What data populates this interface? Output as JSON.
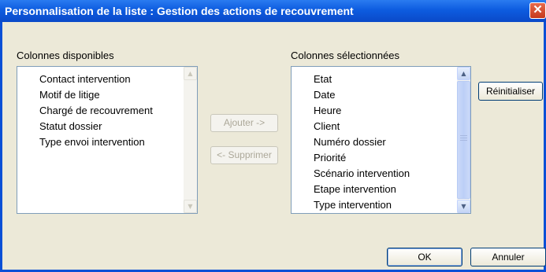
{
  "window": {
    "title": "Personnalisation de la liste : Gestion des actions de recouvrement",
    "close_glyph": "✕"
  },
  "available": {
    "label": "Colonnes disponibles",
    "items": [
      "Contact intervention",
      "Motif de litige",
      "Chargé de recouvrement",
      "Statut dossier",
      "Type envoi intervention"
    ]
  },
  "selected": {
    "label": "Colonnes sélectionnées",
    "items": [
      "Etat",
      "Date",
      "Heure",
      "Client",
      "Numéro dossier",
      "Priorité",
      "Scénario intervention",
      "Etape intervention",
      "Type intervention"
    ]
  },
  "buttons": {
    "add": "Ajouter ->",
    "remove": "<- Supprimer",
    "reset": "Réinitialiser",
    "ok": "OK",
    "cancel": "Annuler"
  },
  "icons": {
    "scroll_up": "▲",
    "scroll_down": "▼"
  }
}
